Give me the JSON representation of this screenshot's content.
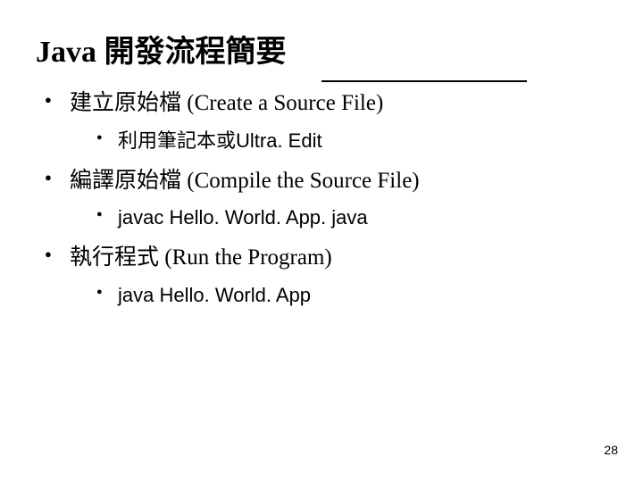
{
  "title": "Java 開發流程簡要",
  "bullets": [
    {
      "text": "建立原始檔 (Create a Source File)",
      "sub": [
        {
          "text": "利用筆記本或Ultra. Edit"
        }
      ]
    },
    {
      "text": "編譯原始檔 (Compile the Source File)",
      "sub": [
        {
          "text": "javac Hello. World. App. java"
        }
      ]
    },
    {
      "text": "執行程式 (Run the Program)",
      "sub": [
        {
          "text": "java Hello. World. App"
        }
      ]
    }
  ],
  "page_number": "28"
}
